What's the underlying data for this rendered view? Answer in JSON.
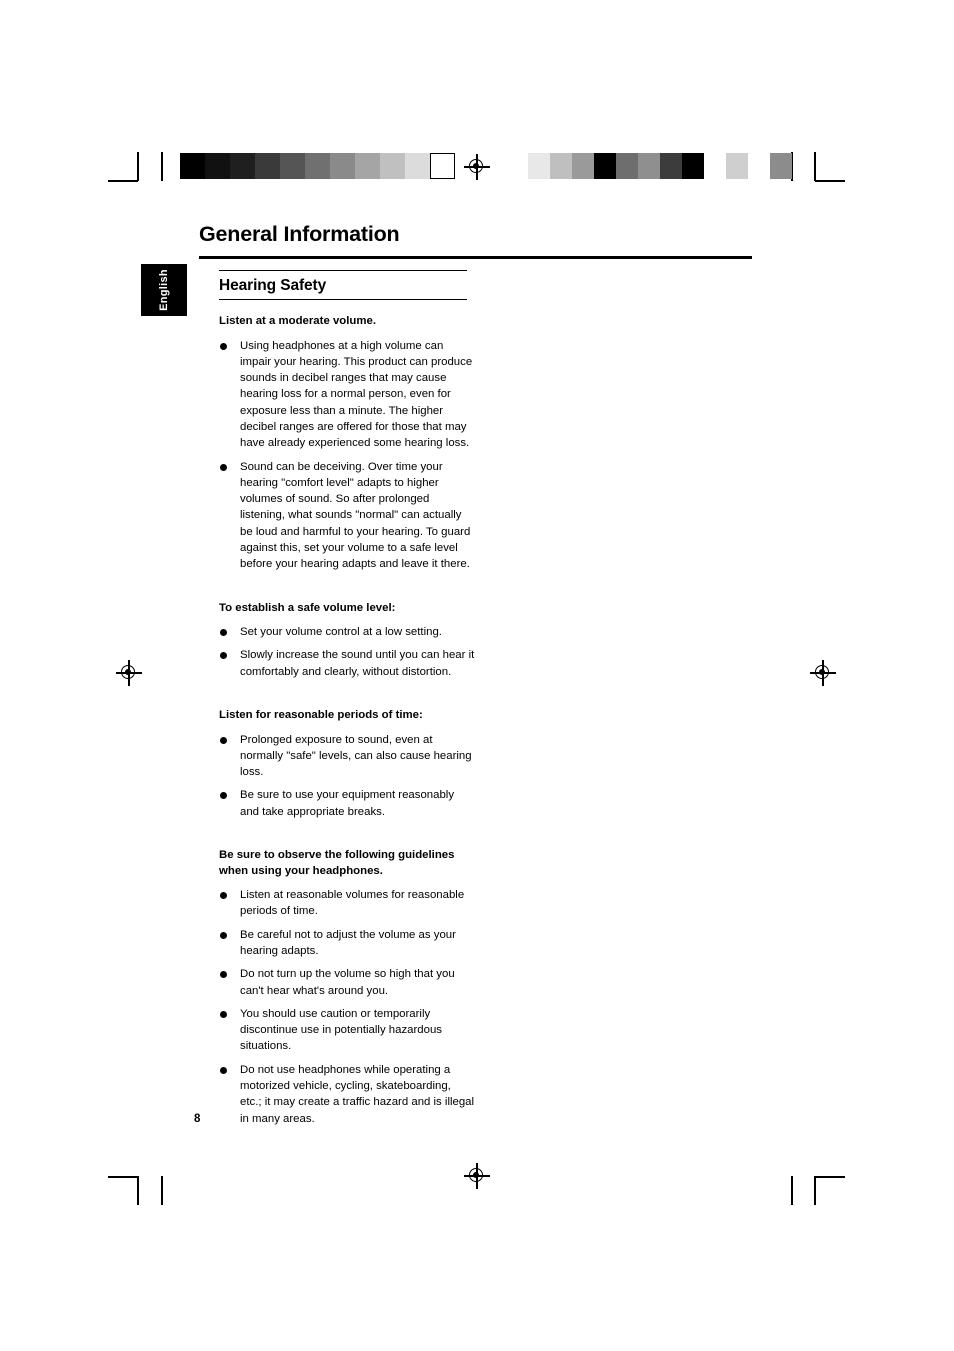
{
  "document": {
    "title": "General Information",
    "language_tab": "English",
    "page_number": "8",
    "section": {
      "heading": "Hearing Safety",
      "groups": [
        {
          "id": "moderate-volume",
          "heading": "Listen at a moderate volume.",
          "bullets": [
            "Using headphones at a high volume can impair your hearing. This product can produce sounds in decibel ranges that may cause hearing loss for a normal person, even for exposure less than a minute. The higher decibel ranges are offered for those that may have already experienced some hearing loss.",
            "Sound can be deceiving.  Over time your hearing \"comfort level\" adapts to higher volumes of sound.  So after prolonged listening, what sounds \"normal\" can actually be loud and harmful to your hearing. To guard against this, set your volume to a safe level before your hearing adapts and leave it there."
          ]
        },
        {
          "id": "safe-volume-level",
          "heading": "To establish a safe volume level:",
          "bullets": [
            "Set your volume control at a low setting.",
            "Slowly increase the sound until you can hear it comfortably and clearly, without distortion."
          ]
        },
        {
          "id": "reasonable-periods",
          "heading": "Listen for reasonable periods of time:",
          "bullets": [
            "Prolonged exposure to sound, even at normally \"safe\" levels, can also cause hearing loss.",
            "Be sure to use your equipment reasonably and take appropriate breaks."
          ]
        },
        {
          "id": "headphone-guidelines",
          "heading": "Be sure to observe the following guidelines when using your headphones.",
          "bullets": [
            "Listen at reasonable volumes for reasonable periods of time.",
            "Be careful not to adjust the volume as your hearing adapts.",
            "Do not turn up the volume so high that you can't hear what's around you.",
            "You should use caution or temporarily discontinue use in potentially hazardous situations.",
            "Do not use headphones while operating a motorized vehicle, cycling, skateboarding, etc.; it may create a traffic hazard and is illegal in many areas."
          ]
        }
      ]
    }
  },
  "print_marks": {
    "left_swatches": [
      "#000000",
      "#111111",
      "#1f1f1f",
      "#3a3a3a",
      "#555555",
      "#707070",
      "#8a8a8a",
      "#a5a5a5",
      "#c0c0c0",
      "#dcdcdc",
      "#ffffff"
    ],
    "right_swatches": [
      "#e8e8e8",
      "#bfbfbf",
      "#9a9a9a",
      "#000000",
      "#6e6e6e",
      "#8f8f8f",
      "#3c3c3c",
      "#000000",
      "#ffffff",
      "#cfcfcf",
      "#ffffff",
      "#8c8c8c"
    ]
  }
}
